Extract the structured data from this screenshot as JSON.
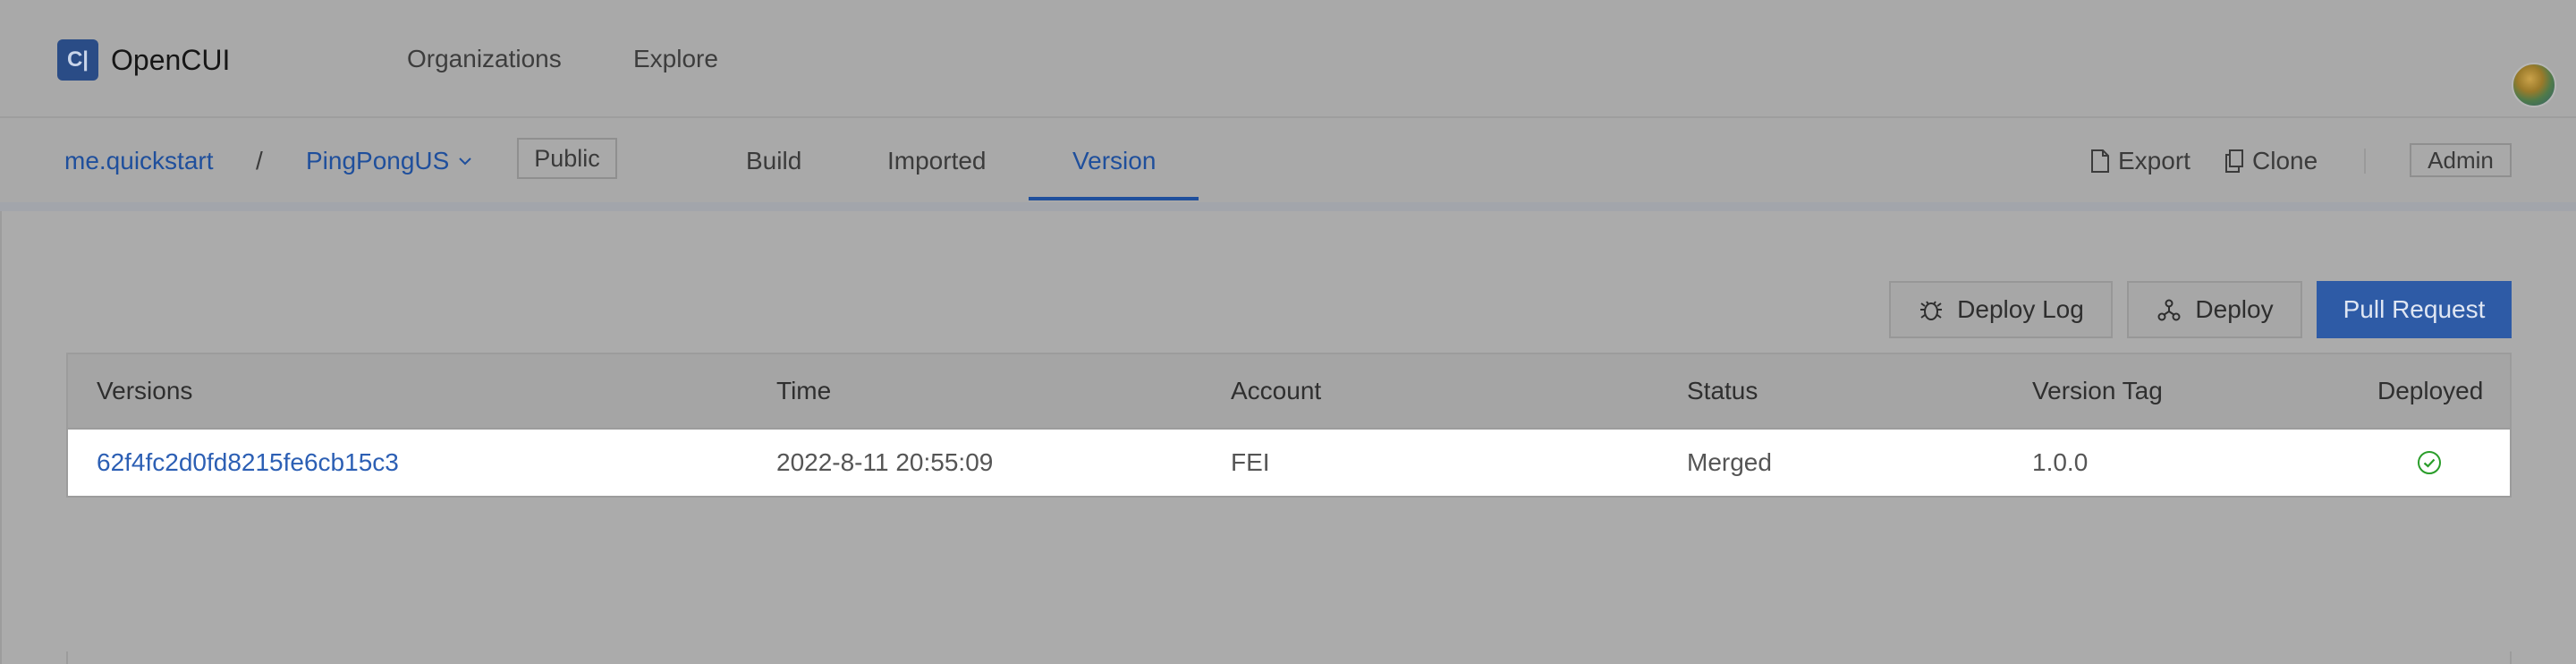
{
  "app": {
    "logo_glyph": "C|",
    "name": "OpenCUI"
  },
  "topnav": {
    "organizations": "Organizations",
    "explore": "Explore"
  },
  "breadcrumb": {
    "org": "me.quickstart",
    "separator": "/",
    "project": "PingPongUS",
    "visibility": "Public"
  },
  "tabs": {
    "build": "Build",
    "imported": "Imported",
    "version": "Version",
    "active": "Version"
  },
  "tools": {
    "export": "Export",
    "clone": "Clone",
    "admin": "Admin"
  },
  "actions": {
    "deploy_log": "Deploy Log",
    "deploy": "Deploy",
    "pull_request": "Pull Request"
  },
  "table": {
    "headers": {
      "versions": "Versions",
      "time": "Time",
      "account": "Account",
      "status": "Status",
      "version_tag": "Version Tag",
      "deployed": "Deployed"
    },
    "rows": [
      {
        "version": "62f4fc2d0fd8215fe6cb15c3",
        "time": "2022-8-11 20:55:09",
        "account": "FEI",
        "status": "Merged",
        "version_tag": "1.0.0",
        "deployed": true
      }
    ]
  },
  "colors": {
    "accent": "#2e5ba6",
    "link": "#1f4f9c",
    "success": "#2a9d2a"
  }
}
